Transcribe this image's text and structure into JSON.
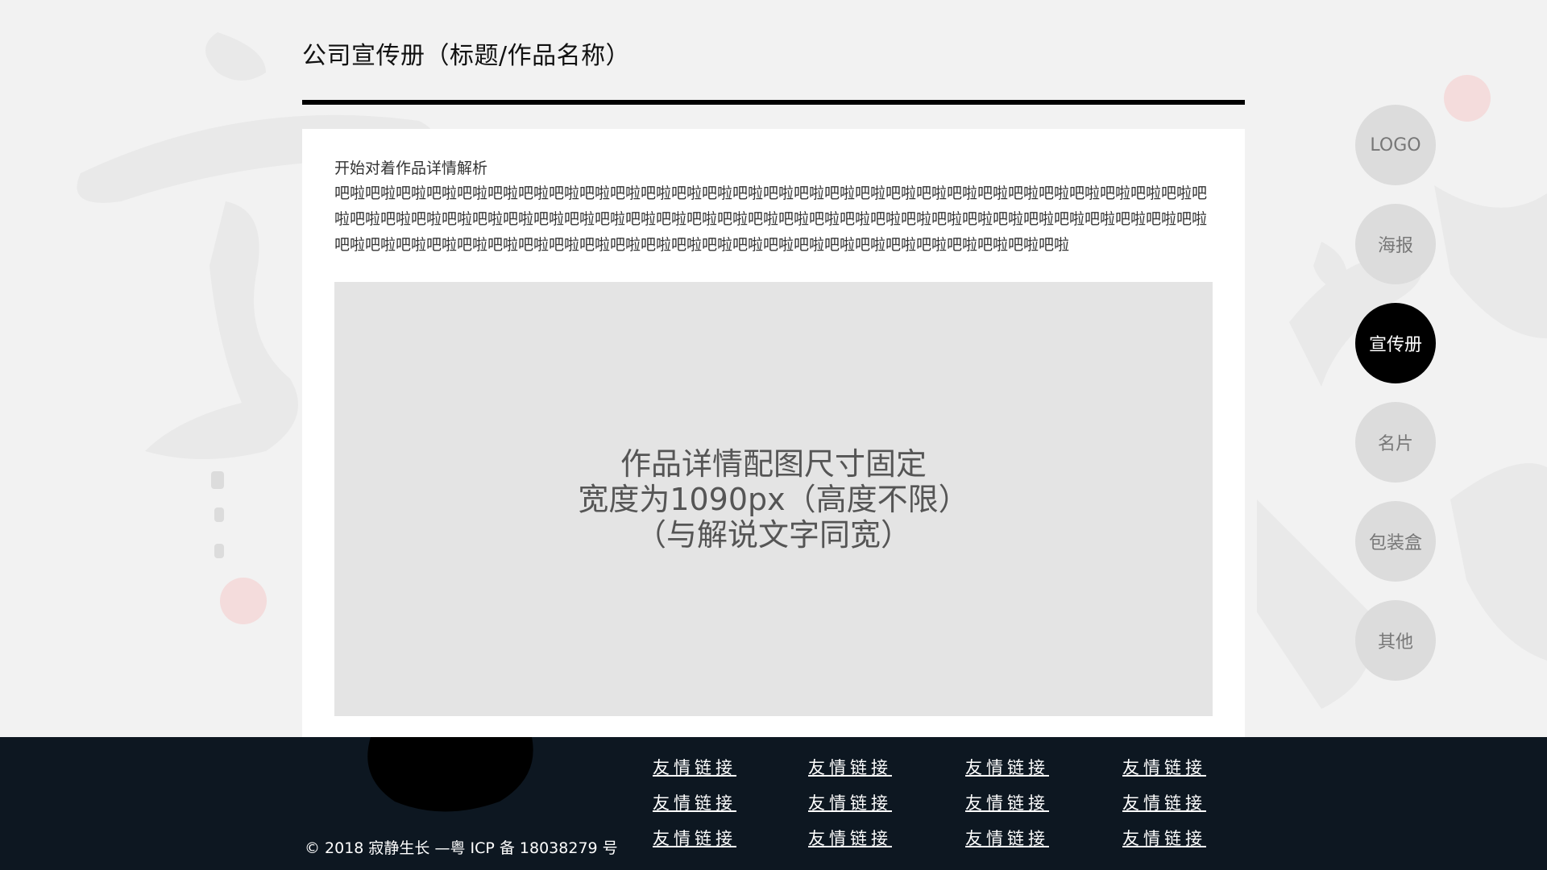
{
  "header": {
    "title": "公司宣传册（标题/作品名称）"
  },
  "content": {
    "intro_heading": "开始对着作品详情解析",
    "intro_body": "吧啦吧啦吧啦吧啦吧啦吧啦吧啦吧啦吧啦吧啦吧啦吧啦吧啦吧啦吧啦吧啦吧啦吧啦吧啦吧啦吧啦吧啦吧啦吧啦吧啦吧啦吧啦吧啦吧啦吧啦吧啦吧啦吧啦吧啦吧啦吧啦吧啦吧啦吧啦吧啦吧啦吧啦吧啦吧啦吧啦吧啦吧啦吧啦吧啦吧啦吧啦吧啦吧啦吧啦吧啦吧啦吧啦吧啦吧啦吧啦吧啦吧啦吧啦吧啦吧啦吧啦吧啦吧啦吧啦吧啦吧啦吧啦吧啦吧啦吧啦吧啦吧啦吧啦吧啦吧啦吧啦",
    "image_placeholder": {
      "line1": "作品详情配图尺寸固定",
      "line2": "宽度为1090px（高度不限）",
      "line3": "（与解说文字同宽）"
    }
  },
  "side_nav": {
    "items": [
      {
        "label": "LOGO",
        "active": false
      },
      {
        "label": "海报",
        "active": false
      },
      {
        "label": "宣传册",
        "active": true
      },
      {
        "label": "名片",
        "active": false
      },
      {
        "label": "包装盒",
        "active": false
      },
      {
        "label": "其他",
        "active": false
      }
    ]
  },
  "footer": {
    "copyright": "© 2018 寂静生长 —粤 ICP 备 18038279 号",
    "links": [
      [
        "友情链接",
        "友情链接",
        "友情链接",
        "友情链接"
      ],
      [
        "友情链接",
        "友情链接",
        "友情链接",
        "友情链接"
      ],
      [
        "友情链接",
        "友情链接",
        "友情链接",
        "友情链接"
      ]
    ]
  },
  "colors": {
    "background": "#f2f2f2",
    "card": "#ffffff",
    "placeholder": "#e4e4e4",
    "nav_inactive": "#dcdcdc",
    "nav_active": "#000000",
    "footer": "#0d1721",
    "seal_red": "#f2dede"
  }
}
